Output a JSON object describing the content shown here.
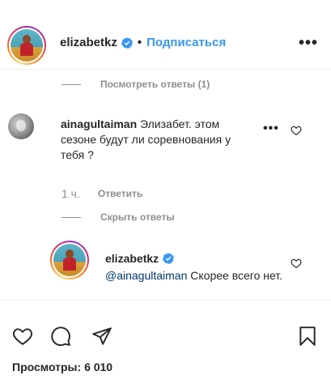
{
  "header": {
    "username": "elizabetkz",
    "separator": "•",
    "follow_label": "Подписаться",
    "more_icon": "more-horizontal-icon",
    "more_label": "•••"
  },
  "thread": {
    "view_replies_label": "Посмотреть ответы (1)",
    "comment": {
      "username": "ainagultaiman",
      "text": "Элизабет. этом сезоне будут ли соревнования у тебя ?",
      "time": "1 ч.",
      "reply_label": "Ответить",
      "more_label": "•••"
    },
    "hide_replies_label": "Скрыть ответы",
    "reply": {
      "username": "elizabetkz",
      "mention": "@ainagultaiman",
      "text": " Скорее всего нет."
    }
  },
  "actions": {
    "icons": [
      "heart-icon",
      "comment-icon",
      "share-icon",
      "bookmark-icon"
    ],
    "views_label": "Просмотры:",
    "views_count": "6 010"
  },
  "colors": {
    "accent_blue": "#3897f0",
    "verified_blue": "#3897f0",
    "muted_gray": "#8e8e8e",
    "text_dark": "#262626",
    "mention_blue": "#00376b"
  }
}
